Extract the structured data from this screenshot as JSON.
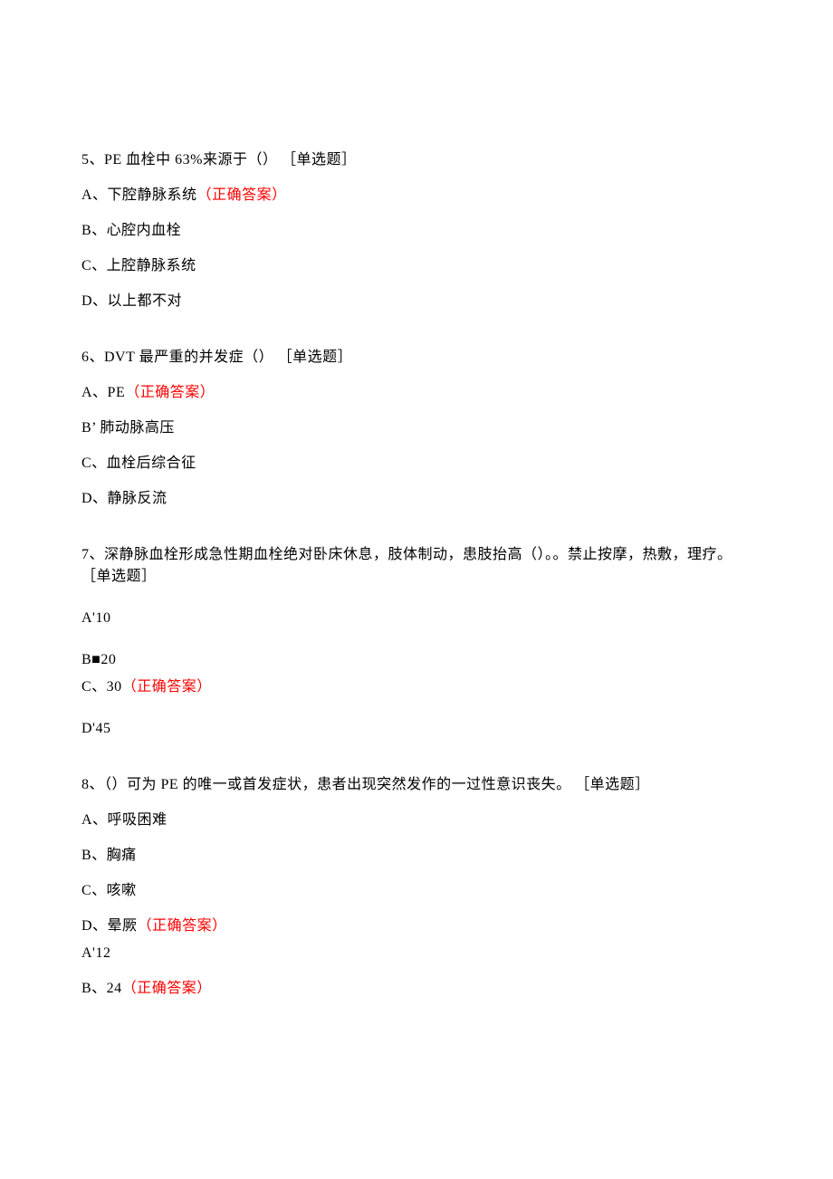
{
  "questions": [
    {
      "stem": "5、PE 血栓中 63%来源于（） ［单选题］",
      "options": [
        {
          "text": "A、下腔静脉系统",
          "correct": true,
          "correct_label": "（正确答案）"
        },
        {
          "text": "B、心腔内血栓",
          "correct": false
        },
        {
          "text": "C、上腔静脉系统",
          "correct": false
        },
        {
          "text": "D、以上都不对",
          "correct": false
        }
      ]
    },
    {
      "stem": "6、DVT 最严重的并发症（） ［单选题］",
      "options": [
        {
          "text": "A、PE",
          "correct": true,
          "correct_label": "（正确答案）"
        },
        {
          "text": "B’ 肺动脉高压",
          "correct": false
        },
        {
          "text": "C、血栓后综合征",
          "correct": false
        },
        {
          "text": "D、静脉反流",
          "correct": false
        }
      ]
    },
    {
      "stem": "7、深静脉血栓形成急性期血栓绝对卧床休息，肢体制动，患肢抬高（）。。禁止按摩，热敷，理疗。 ［单选题］",
      "options": [
        {
          "text": "A'10",
          "correct": false,
          "gap": true
        },
        {
          "text": "B■20",
          "correct": false,
          "tight": true
        },
        {
          "text": "C、30",
          "correct": true,
          "correct_label": "（正确答案）",
          "gap": true
        },
        {
          "text": "D'45",
          "correct": false
        }
      ]
    },
    {
      "stem": "8、（）可为 PE 的唯一或首发症状，患者出现突然发作的一过性意识丧失。 ［单选题］",
      "options": [
        {
          "text": "A、呼吸困难",
          "correct": false
        },
        {
          "text": "B、胸痛",
          "correct": false
        },
        {
          "text": "C、咳嗽",
          "correct": false
        },
        {
          "text": "D、晕厥",
          "correct": true,
          "correct_label": "（正确答案）",
          "tight": true
        },
        {
          "text": "A'12",
          "correct": false
        },
        {
          "text": "B、24",
          "correct": true,
          "correct_label": "（正确答案）"
        }
      ]
    }
  ]
}
